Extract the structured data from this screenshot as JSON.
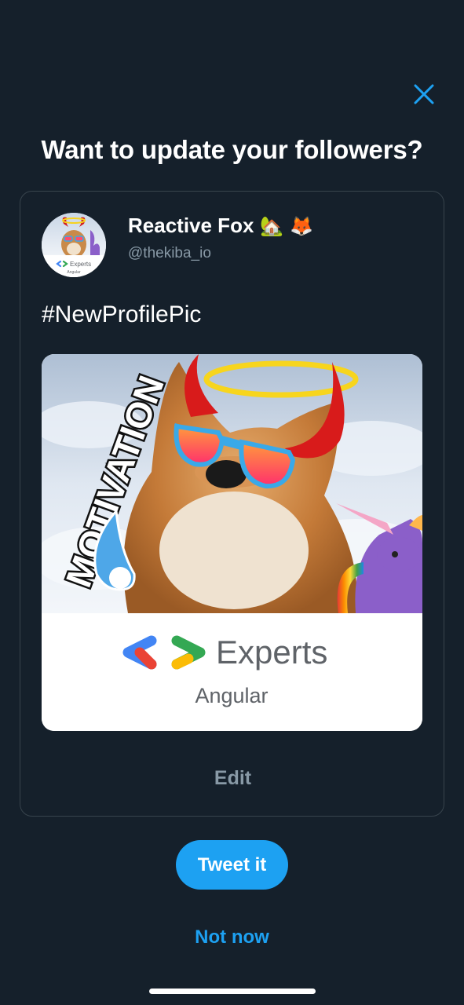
{
  "dialog": {
    "title": "Want to update your followers?",
    "close_icon": "close-icon"
  },
  "tweet": {
    "name": "Reactive Fox",
    "name_emojis": [
      "🏡",
      "🦊"
    ],
    "handle": "@thekiba_io",
    "text": "#NewProfilePic",
    "media": {
      "sticker_text": "MOTIVATION",
      "logo_word": "Experts",
      "logo_subtitle": "Angular"
    },
    "avatar": {
      "logo_word": "Experts",
      "logo_subtitle": "Angular"
    }
  },
  "actions": {
    "edit_label": "Edit",
    "tweet_label": "Tweet it",
    "not_now_label": "Not now"
  },
  "colors": {
    "background": "#15202b",
    "accent": "#1da1f2",
    "muted": "#8899a6",
    "border": "#38444d"
  }
}
